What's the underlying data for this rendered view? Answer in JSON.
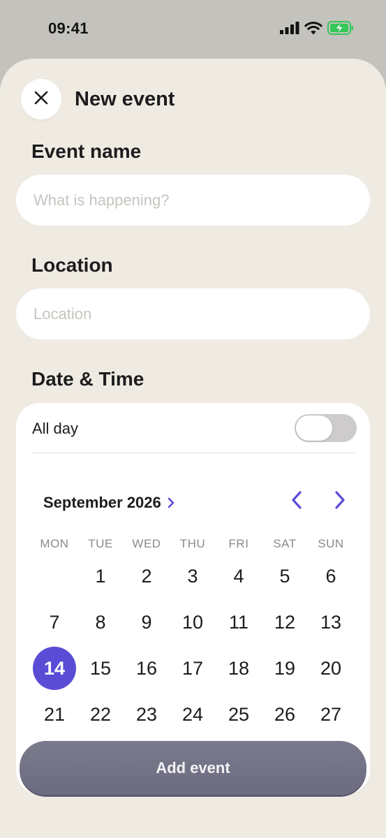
{
  "status_bar": {
    "time": "09:41",
    "icons": [
      "cellular-signal-icon",
      "wifi-icon",
      "battery-charging-icon"
    ]
  },
  "header": {
    "title": "New event",
    "close_icon": "close-icon"
  },
  "event_name": {
    "label": "Event name",
    "value": "",
    "placeholder": "What is happening?"
  },
  "location": {
    "label": "Location",
    "value": "",
    "placeholder": "Location"
  },
  "date_time": {
    "label": "Date & Time",
    "all_day_label": "All day",
    "all_day_on": false
  },
  "calendar": {
    "month_label": "September 2026",
    "weekdays": [
      "MON",
      "TUE",
      "WED",
      "THU",
      "FRI",
      "SAT",
      "SUN"
    ],
    "weeks": [
      [
        "",
        "1",
        "2",
        "3",
        "4",
        "5",
        "6"
      ],
      [
        "7",
        "8",
        "9",
        "10",
        "11",
        "12",
        "13"
      ],
      [
        "14",
        "15",
        "16",
        "17",
        "18",
        "19",
        "20"
      ],
      [
        "21",
        "22",
        "23",
        "24",
        "25",
        "26",
        "27"
      ]
    ],
    "selected_day": "14"
  },
  "footer": {
    "add_label": "Add event"
  },
  "colors": {
    "accent": "#5b4cd6",
    "sheet_background": "#efebe2",
    "button": "#74748a"
  }
}
